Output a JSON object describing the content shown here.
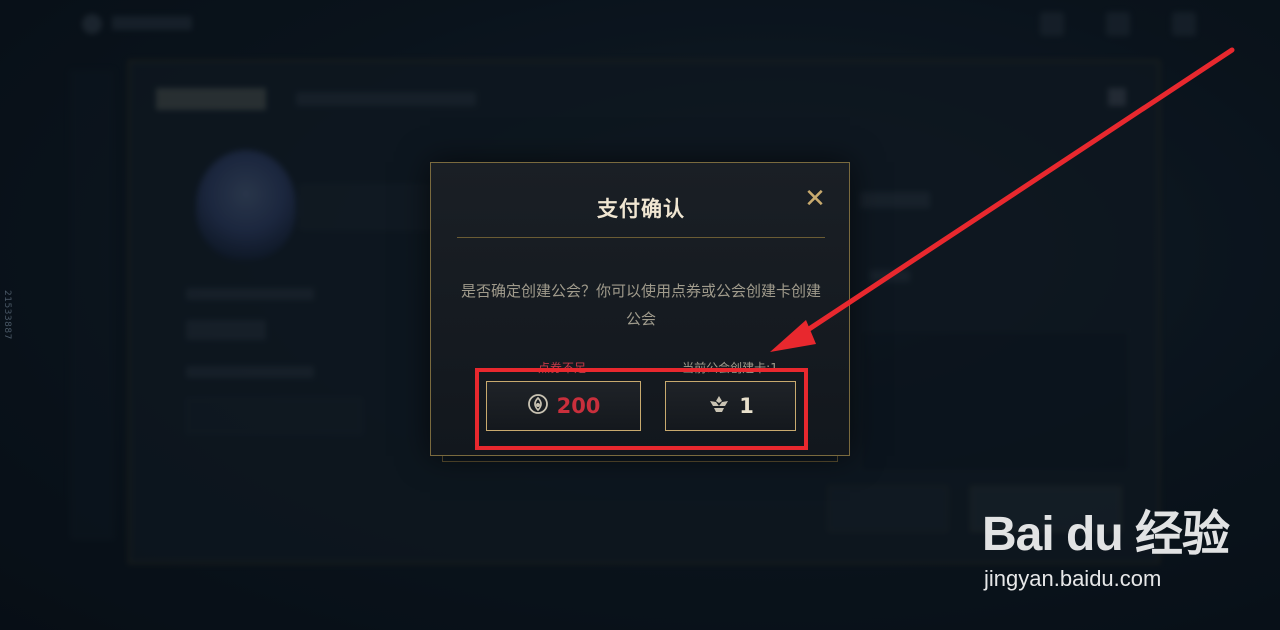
{
  "side_id": "21533887",
  "dialog": {
    "title": "支付确认",
    "close_symbol": "✕",
    "message": "是否确定创建公会？你可以使用点券或公会创建卡创建公会",
    "rp_warning": "点券不足",
    "card_info": "当前公会创建卡:1",
    "rp_button": {
      "icon": "rp-coin-icon",
      "value": "200"
    },
    "card_button": {
      "icon": "guild-card-icon",
      "value": "1"
    }
  },
  "watermark": {
    "logo": "Bai du 经验",
    "url": "jingyan.baidu.com"
  },
  "colors": {
    "accent_gold": "#c8aa6e",
    "warning_red": "#c33a48",
    "annotation_red": "#e8282e"
  }
}
